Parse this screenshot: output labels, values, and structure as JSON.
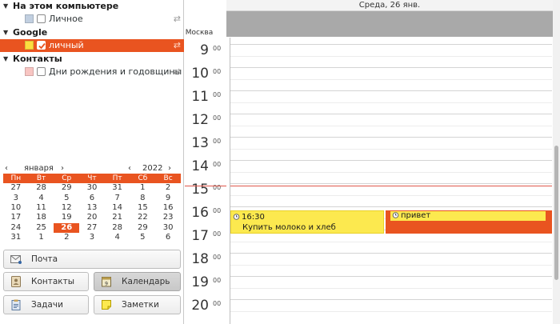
{
  "sidebar": {
    "groups": [
      {
        "title": "На этом компьютере",
        "calendars": [
          {
            "label": "Личное",
            "color": "#c1cfe0",
            "checked": false,
            "selected": false
          }
        ]
      },
      {
        "title": "Google",
        "calendars": [
          {
            "label": "личный",
            "color": "#fcdd3f",
            "checked": true,
            "selected": true
          }
        ]
      },
      {
        "title": "Контакты",
        "calendars": [
          {
            "label": "Дни рождения и годовщины",
            "color": "#f8c5c2",
            "checked": false,
            "selected": false
          }
        ]
      }
    ]
  },
  "mini_calendar": {
    "month": "января",
    "year": "2022",
    "weekdays": [
      "Пн",
      "Вт",
      "Ср",
      "Чт",
      "Пт",
      "Сб",
      "Вс"
    ],
    "weeks": [
      [
        "27",
        "28",
        "29",
        "30",
        "31",
        "1",
        "2"
      ],
      [
        "3",
        "4",
        "5",
        "6",
        "7",
        "8",
        "9"
      ],
      [
        "10",
        "11",
        "12",
        "13",
        "14",
        "15",
        "16"
      ],
      [
        "17",
        "18",
        "19",
        "20",
        "21",
        "22",
        "23"
      ],
      [
        "24",
        "25",
        "26",
        "27",
        "28",
        "29",
        "30"
      ],
      [
        "31",
        "1",
        "2",
        "3",
        "4",
        "5",
        "6"
      ]
    ],
    "today": "26"
  },
  "switcher": {
    "mail": "Почта",
    "contacts": "Контакты",
    "calendar": "Календарь",
    "tasks": "Задачи",
    "memos": "Заметки"
  },
  "day_view": {
    "header": "Среда, 26 янв.",
    "timezone": "Москва",
    "hours": [
      "9",
      "10",
      "11",
      "12",
      "13",
      "14",
      "15",
      "16",
      "17",
      "18",
      "19",
      "20"
    ],
    "minutes_label": "00",
    "events": [
      {
        "time": "16:30",
        "title": "Купить молоко и хлеб",
        "color": "#fce94f"
      },
      {
        "time": "",
        "title": "привет",
        "color": "#f57900"
      }
    ]
  },
  "colors": {
    "accent": "#e95420",
    "now_line": "#e0584b"
  }
}
